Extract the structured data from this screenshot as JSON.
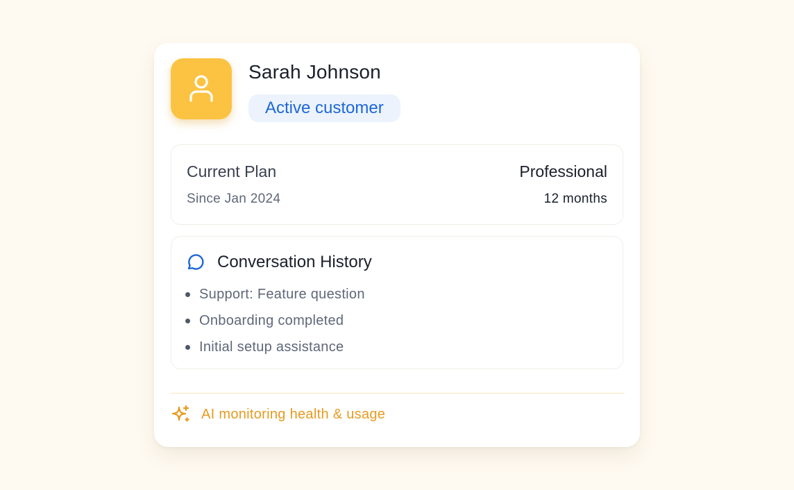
{
  "customer": {
    "name": "Sarah Johnson",
    "status": "Active customer",
    "avatar_icon": "user-icon"
  },
  "plan": {
    "label": "Current Plan",
    "name": "Professional",
    "since": "Since Jan 2024",
    "duration": "12 months"
  },
  "history": {
    "icon": "message-circle-icon",
    "title": "Conversation History",
    "items": [
      "Support: Feature question",
      "Onboarding completed",
      "Initial setup assistance"
    ]
  },
  "footer": {
    "icon": "sparkles-icon",
    "text": "AI monitoring health & usage"
  },
  "colors": {
    "page_background": "#fffaf1",
    "avatar": "#fcc343",
    "badge_text": "#1d67d8",
    "badge_background": "#ecf3fd",
    "ai_accent": "#e79a1f"
  }
}
